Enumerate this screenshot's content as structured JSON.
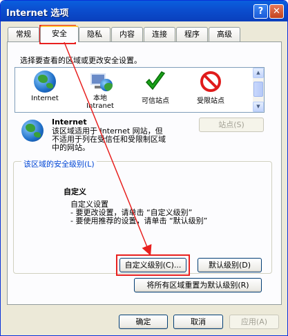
{
  "window": {
    "title": "Internet 选项",
    "help_btn": "?",
    "close_btn": "✕"
  },
  "tabs": [
    "常规",
    "安全",
    "隐私",
    "内容",
    "连接",
    "程序",
    "高级"
  ],
  "active_tab": "安全",
  "select_zone_label": "选择要查看的区域或更改安全设置。",
  "zones": [
    {
      "label": "Internet"
    },
    {
      "label": "本地\nIntranet"
    },
    {
      "label": "可信站点"
    },
    {
      "label": "受限站点"
    }
  ],
  "zone_info": {
    "title": "Internet",
    "description": "该区域适用于 Internet 网站，但\n不适用于列在受信任和受限制区域\n中的网站。"
  },
  "sites_button": "站点(S)",
  "security_level": {
    "legend": "该区域的安全级别(L)",
    "name": "自定义",
    "line1": "自定义设置",
    "line2": "- 要更改设置，请单击 “自定义级别”",
    "line3": "- 要使用推荐的设置，请单击 “默认级别”"
  },
  "custom_level_button": "自定义级别(C)...",
  "default_level_button": "默认级别(D)",
  "reset_all_button": "将所有区域重置为默认级别(R)",
  "ok_button": "确定",
  "cancel_button": "取消",
  "apply_button": "应用(A)",
  "annotation_color": "#e8201f"
}
